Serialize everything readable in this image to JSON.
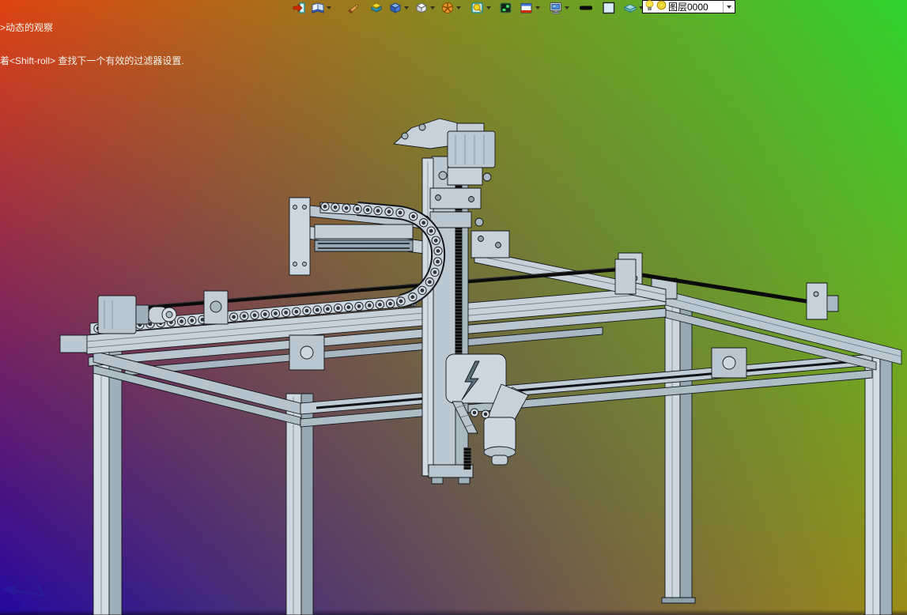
{
  "status": {
    "line1": ">动态的观察",
    "line2": "着<Shift-roll> 查找下一个有效的过滤器设置."
  },
  "toolbar": {
    "icons": [
      {
        "id": "exit",
        "dropdown": false
      },
      {
        "id": "notebook",
        "dropdown": true
      },
      {
        "id": "pencil",
        "dropdown": false
      },
      {
        "id": "box-lid",
        "dropdown": false
      },
      {
        "id": "blue-cube",
        "dropdown": true
      },
      {
        "id": "white-cube",
        "dropdown": true
      },
      {
        "id": "orange-segments",
        "dropdown": true
      },
      {
        "id": "magnifier-doc",
        "dropdown": true
      },
      {
        "id": "dark-panel",
        "dropdown": false
      },
      {
        "id": "window-frame",
        "dropdown": true
      },
      {
        "id": "monitor",
        "dropdown": true
      },
      {
        "id": "line-width",
        "dropdown": false
      },
      {
        "id": "color-swatch",
        "dropdown": false
      },
      {
        "id": "teal-slab",
        "dropdown": true
      }
    ],
    "layer_combo": {
      "value": "图层0000",
      "icons": [
        "bulb-icon",
        "ring-icon"
      ]
    }
  },
  "viewport": {
    "background_corners": {
      "top_left": "#df4412",
      "top_right": "#2fd42f",
      "bottom_left": "#2408a0",
      "bottom_right": "#9d8c16"
    },
    "model_name": "gantry-robot-3d-model",
    "model_colors": {
      "body": "#c6d1da",
      "light_face": "#d6dee5",
      "dark_face": "#a2b1bc",
      "outline": "#14181d",
      "shaft": "#0b0b0b"
    }
  },
  "axis_indicator": {
    "color": "#2a1d9c"
  }
}
